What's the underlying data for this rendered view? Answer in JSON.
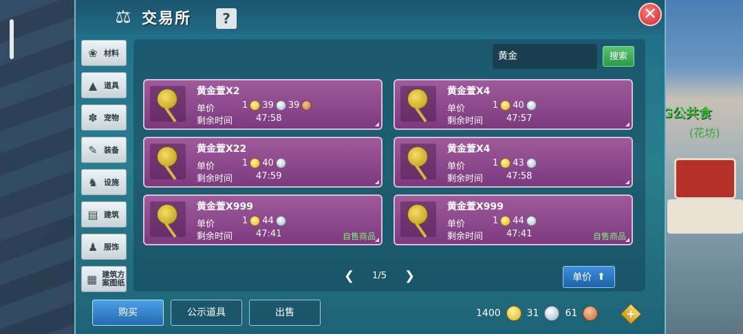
{
  "title": "交易所",
  "help_label": "?",
  "close_label": "✕",
  "categories": [
    {
      "label": "材料",
      "icon": "materials-icon"
    },
    {
      "label": "道具",
      "icon": "item-icon"
    },
    {
      "label": "宠物",
      "icon": "paw-icon"
    },
    {
      "label": "装备",
      "icon": "equipment-icon"
    },
    {
      "label": "设施",
      "icon": "facility-icon"
    },
    {
      "label": "建筑",
      "icon": "building-icon"
    },
    {
      "label": "服饰",
      "icon": "clothing-icon"
    },
    {
      "label": "建筑方案图纸",
      "icon": "blueprint-icon"
    }
  ],
  "search": {
    "value": "黄金",
    "button": "搜索"
  },
  "listings": [
    {
      "name": "黄金萱X2",
      "price_label": "单价",
      "gold": "1",
      "silver": "39",
      "copper": "39",
      "time_label": "剩余时间",
      "time": "47:58",
      "self": ""
    },
    {
      "name": "黄金萱X4",
      "price_label": "单价",
      "gold": "1",
      "silver": "40",
      "copper": "",
      "time_label": "剩余时间",
      "time": "47:57",
      "self": ""
    },
    {
      "name": "黄金萱X22",
      "price_label": "单价",
      "gold": "1",
      "silver": "40",
      "copper": "",
      "time_label": "剩余时间",
      "time": "47:59",
      "self": ""
    },
    {
      "name": "黄金萱X4",
      "price_label": "单价",
      "gold": "1",
      "silver": "43",
      "copper": "",
      "time_label": "剩余时间",
      "time": "47:58",
      "self": ""
    },
    {
      "name": "黄金萱X999",
      "price_label": "单价",
      "gold": "1",
      "silver": "44",
      "copper": "",
      "time_label": "剩余时间",
      "time": "47:41",
      "self": "自售商品"
    },
    {
      "name": "黄金萱X999",
      "price_label": "单价",
      "gold": "1",
      "silver": "44",
      "copper": "",
      "time_label": "剩余时间",
      "time": "47:41",
      "self": "自售商品"
    }
  ],
  "pager": {
    "text": "1/5"
  },
  "sort_button": "单价",
  "tabs": {
    "buy": "购买",
    "public": "公示道具",
    "sell": "出售"
  },
  "currency": {
    "gold": "1400",
    "silver": "31",
    "copper": "61"
  },
  "scene": {
    "text1": "G公共食",
    "text2": "(花坊)"
  }
}
